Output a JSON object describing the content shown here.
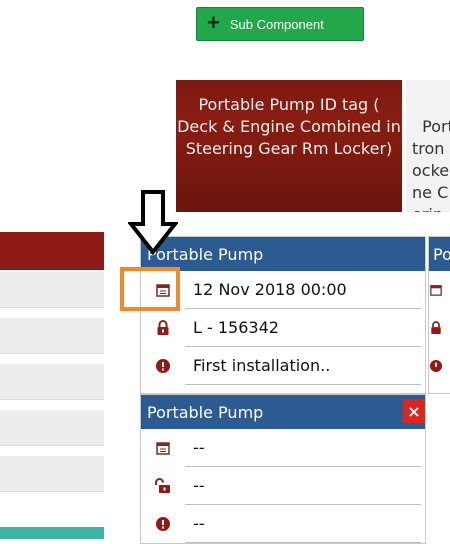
{
  "toolbar": {
    "sub_component_label": "Sub Component"
  },
  "title_card": {
    "text": "Portable Pump ID tag ( Deck & Engine Combined in Steering Gear Rm Locker)",
    "next_partial": "Port\ntron\nocke\nne C\nerin"
  },
  "cards": [
    {
      "header": "Portable Pump",
      "rows": [
        {
          "icon": "calendar-icon",
          "value": "12 Nov 2018 00:00"
        },
        {
          "icon": "lock-icon",
          "value": "L - 156342"
        },
        {
          "icon": "info-icon",
          "value": "First installation.."
        }
      ]
    },
    {
      "header": "Portable Pump",
      "close": "×",
      "rows": [
        {
          "icon": "calendar-icon",
          "value": "--"
        },
        {
          "icon": "unlock-icon",
          "value": "--"
        },
        {
          "icon": "info-icon",
          "value": "--"
        }
      ]
    }
  ],
  "card_right_partial": {
    "header": "Po"
  },
  "colors": {
    "accent_green": "#22a84a",
    "header_blue": "#2b5b92",
    "title_red": "#7a1a10",
    "highlight_orange": "#f08a2e",
    "close_red": "#d9271d"
  }
}
